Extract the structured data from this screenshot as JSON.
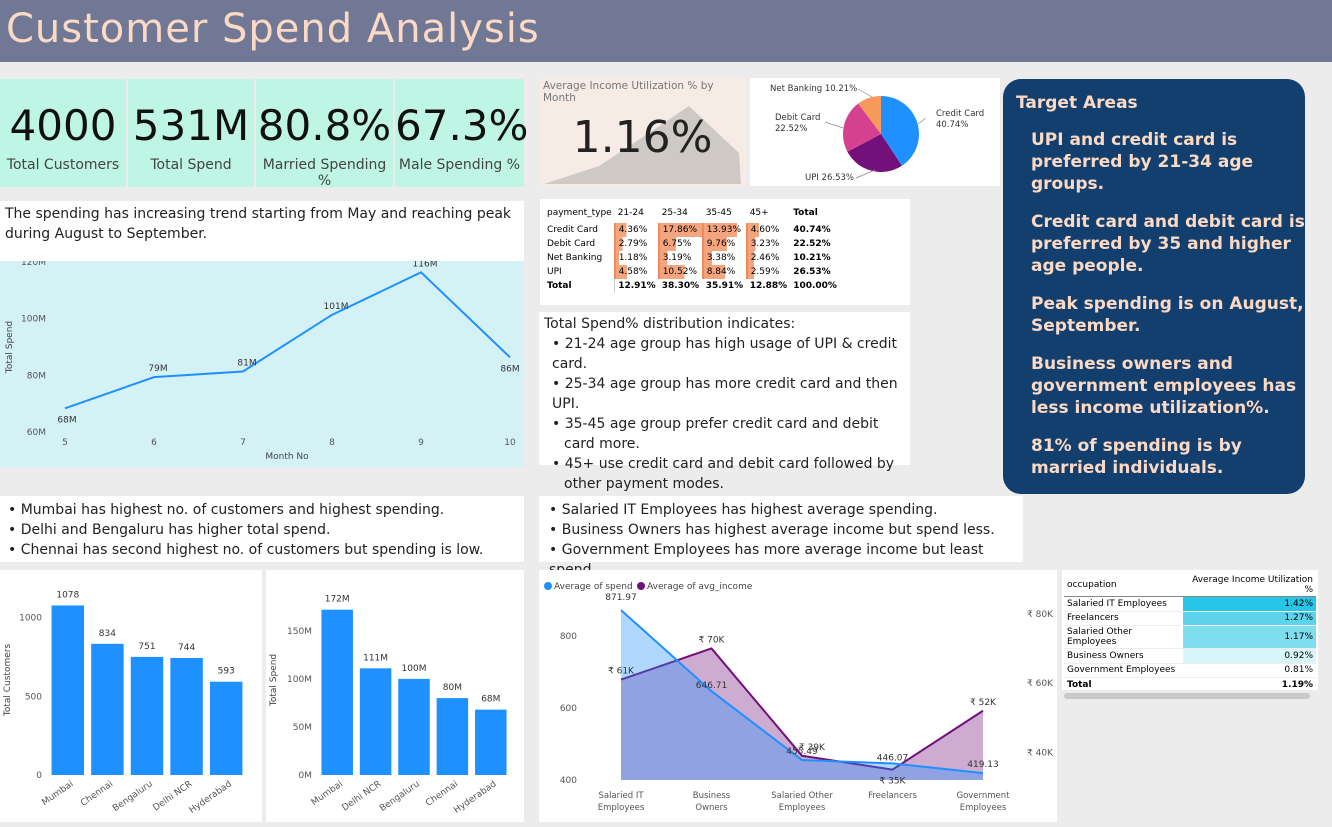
{
  "header": {
    "title": "Customer Spend Analysis"
  },
  "kpis": [
    {
      "value": "4000",
      "label": "Total Customers"
    },
    {
      "value": "531M",
      "label": "Total Spend"
    },
    {
      "value": "80.8%",
      "label": "Married Spending %"
    },
    {
      "value": "67.3%",
      "label": "Male Spending %"
    }
  ],
  "income_util": {
    "title": "Average Income Utilization % by Month",
    "value": "1.16%"
  },
  "trend_text": "The spending has increasing trend starting from May and reaching peak during August to September.",
  "pt_text": {
    "heading": "Total Spend% distribution indicates:",
    "bullets": [
      "21-24 age group has high usage of UPI & credit card.",
      "25-34 age group has more credit card and then UPI.",
      "35-45 age group prefer credit card and debit card more.",
      "45+ use credit card and debit card followed by other payment modes."
    ]
  },
  "city_text": [
    "Mumbai has highest no. of customers and highest spending.",
    "Delhi and Bengaluru has higher total spend.",
    "Chennai has second highest no. of  customers but spending is low."
  ],
  "occ_text": [
    "Salaried IT Employees has highest average spending.",
    "Business Owners has highest average income but spend less.",
    "Government Employees has more average income but least spend."
  ],
  "target": {
    "title": "Target Areas",
    "items": [
      "UPI and credit card is preferred by 21-34 age groups.",
      "Credit card and debit card is preferred by 35 and higher age people.",
      "Peak spending is on August, September.",
      "Business owners and government employees has less income utilization%.",
      "81% of spending is by married individuals."
    ]
  },
  "pivot": {
    "headers": [
      "payment_type",
      "21-24",
      "25-34",
      "35-45",
      "45+",
      "Total"
    ],
    "rows": [
      [
        "Credit Card",
        "4.36%",
        "17.86%",
        "13.93%",
        "4.60%",
        "40.74%"
      ],
      [
        "Debit Card",
        "2.79%",
        "6.75%",
        "9.76%",
        "3.23%",
        "22.52%"
      ],
      [
        "Net Banking",
        "1.18%",
        "3.19%",
        "3.38%",
        "2.46%",
        "10.21%"
      ],
      [
        "UPI",
        "4.58%",
        "10.52%",
        "8.84%",
        "2.59%",
        "26.53%"
      ]
    ],
    "total": [
      "Total",
      "12.91%",
      "38.30%",
      "35.91%",
      "12.88%",
      "100.00%"
    ],
    "bar_color": "#f4a57e"
  },
  "occ_table": {
    "headers": [
      "occupation",
      "Average Income Utilization %"
    ],
    "rows": [
      [
        "Salaried IT Employees",
        "1.42%"
      ],
      [
        "Freelancers",
        "1.27%"
      ],
      [
        "Salaried Other Employees",
        "1.17%"
      ],
      [
        "Business Owners",
        "0.92%"
      ],
      [
        "Government Employees",
        "0.81%"
      ]
    ],
    "total": [
      "Total",
      "1.19%"
    ]
  },
  "chart_data": [
    {
      "type": "pie",
      "categories": [
        "Credit Card",
        "UPI",
        "Debit Card",
        "Net Banking"
      ],
      "values": [
        40.74,
        26.53,
        22.52,
        10.21
      ],
      "labels": [
        "Credit Card 40.74%",
        "UPI 26.53%",
        "Debit Card 22.52%",
        "Net Banking 10.21%"
      ],
      "colors": [
        "#1e90ff",
        "#74107a",
        "#d6418f",
        "#f59a5a"
      ]
    },
    {
      "type": "line",
      "x": [
        5,
        6,
        7,
        8,
        9,
        10
      ],
      "values": [
        68,
        79,
        81,
        101,
        116,
        86
      ],
      "labels": [
        "68M",
        "79M",
        "81M",
        "101M",
        "116M",
        "86M"
      ],
      "xlabel": "Month No",
      "ylabel": "Total Spend",
      "yticks": [
        "60M",
        "80M",
        "100M",
        "120M"
      ],
      "ylim": [
        60,
        120
      ],
      "color": "#1e90ff"
    },
    {
      "type": "bar",
      "categories": [
        "Mumbai",
        "Chennai",
        "Bengaluru",
        "Delhi NCR",
        "Hyderabad"
      ],
      "values": [
        1078,
        834,
        751,
        744,
        593
      ],
      "ylabel": "Total Customers",
      "yticks": [
        "0",
        "500",
        "1000"
      ],
      "ylim": [
        0,
        1100
      ],
      "color": "#1e90ff"
    },
    {
      "type": "bar",
      "categories": [
        "Mumbai",
        "Delhi NCR",
        "Bengaluru",
        "Chennai",
        "Hyderabad"
      ],
      "values": [
        172,
        111,
        100,
        80,
        68
      ],
      "labels": [
        "172M",
        "111M",
        "100M",
        "80M",
        "68M"
      ],
      "ylabel": "Total Spend",
      "yticks": [
        "0M",
        "50M",
        "100M",
        "150M"
      ],
      "ylim": [
        0,
        180
      ],
      "color": "#1e90ff"
    },
    {
      "type": "area",
      "categories": [
        "Salaried IT Employees",
        "Business Owners",
        "Salaried Other Employees",
        "Freelancers",
        "Government Employees"
      ],
      "series": [
        {
          "name": "Average of spend",
          "values": [
            871.97,
            646.71,
            455.49,
            446.07,
            419.13
          ],
          "labels": [
            "871.97",
            "646.71",
            "455.49",
            "446.07",
            "419.13"
          ],
          "color": "#1e90ff"
        },
        {
          "name": "Average of avg_income",
          "values": [
            61,
            70,
            39,
            35,
            52
          ],
          "labels": [
            "₹ 61K",
            "₹ 70K",
            "₹ 39K",
            "₹ 35K",
            "₹ 52K"
          ],
          "color": "#74107a"
        }
      ],
      "yticks_left": [
        "400",
        "600",
        "800"
      ],
      "ylim_left": [
        400,
        900
      ],
      "yticks_right": [
        "₹ 40K",
        "₹ 60K",
        "₹ 80K"
      ],
      "ylim_right": [
        32,
        84
      ]
    }
  ]
}
